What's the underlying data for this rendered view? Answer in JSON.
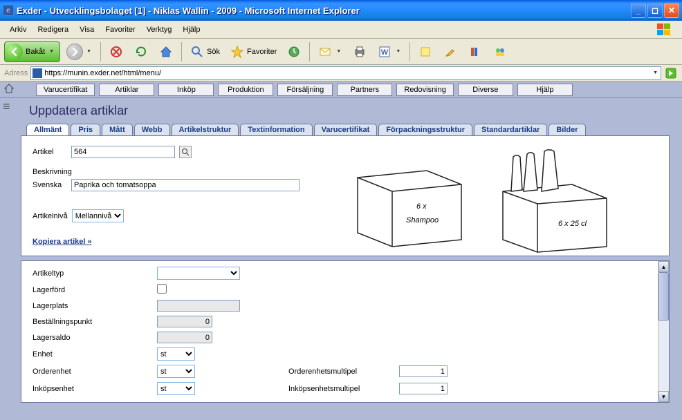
{
  "window": {
    "title": "Exder - Utvecklingsbolaget [1] - Niklas Wallin - 2009 - Microsoft Internet Explorer"
  },
  "menubar": {
    "items": [
      "Arkiv",
      "Redigera",
      "Visa",
      "Favoriter",
      "Verktyg",
      "Hjälp"
    ]
  },
  "toolbar": {
    "back": "Bakåt",
    "search": "Sök",
    "favorites": "Favoriter"
  },
  "addressbar": {
    "label": "Adress",
    "url": "https://munin.exder.net/html/menu/"
  },
  "app_tabs": [
    "Varucertifikat",
    "Artiklar",
    "Inköp",
    "Produktion",
    "Försäljning",
    "Partners",
    "Redovisning",
    "Diverse",
    "Hjälp"
  ],
  "page": {
    "title": "Uppdatera artiklar",
    "tabs": [
      "Allmänt",
      "Pris",
      "Mått",
      "Webb",
      "Artikelstruktur",
      "Textinformation",
      "Varucertifikat",
      "Förpackningsstruktur",
      "Standardartiklar",
      "Bilder"
    ],
    "active_tab": "Allmänt"
  },
  "form": {
    "artikel_label": "Artikel",
    "artikel_value": "564",
    "beskrivning_label": "Beskrivning",
    "svenska_label": "Svenska",
    "svenska_value": "Paprika och tomatsoppa",
    "artikelniva_label": "Artikelnivå",
    "artikelniva_value": "Mellannivå",
    "kopiera_link": "Kopiera artikel »"
  },
  "lower": {
    "artikeltyp_label": "Artikeltyp",
    "artikeltyp_value": "",
    "lagerford_label": "Lagerförd",
    "lagerplats_label": "Lagerplats",
    "lagerplats_value": "",
    "bestallningspunkt_label": "Beställningspunkt",
    "bestallningspunkt_value": "0",
    "lagersaldo_label": "Lagersaldo",
    "lagersaldo_value": "0",
    "enhet_label": "Enhet",
    "enhet_value": "st",
    "orderenhet_label": "Orderenhet",
    "orderenhet_value": "st",
    "orderenhetsmultipel_label": "Orderenhetsmultipel",
    "orderenhetsmultipel_value": "1",
    "inkopsenhet_label": "Inköpsenhet",
    "inkopsenhet_value": "st",
    "inkopsenhetsmultipel_label": "Inköpsenhetsmultipel",
    "inkopsenhetsmultipel_value": "1"
  }
}
